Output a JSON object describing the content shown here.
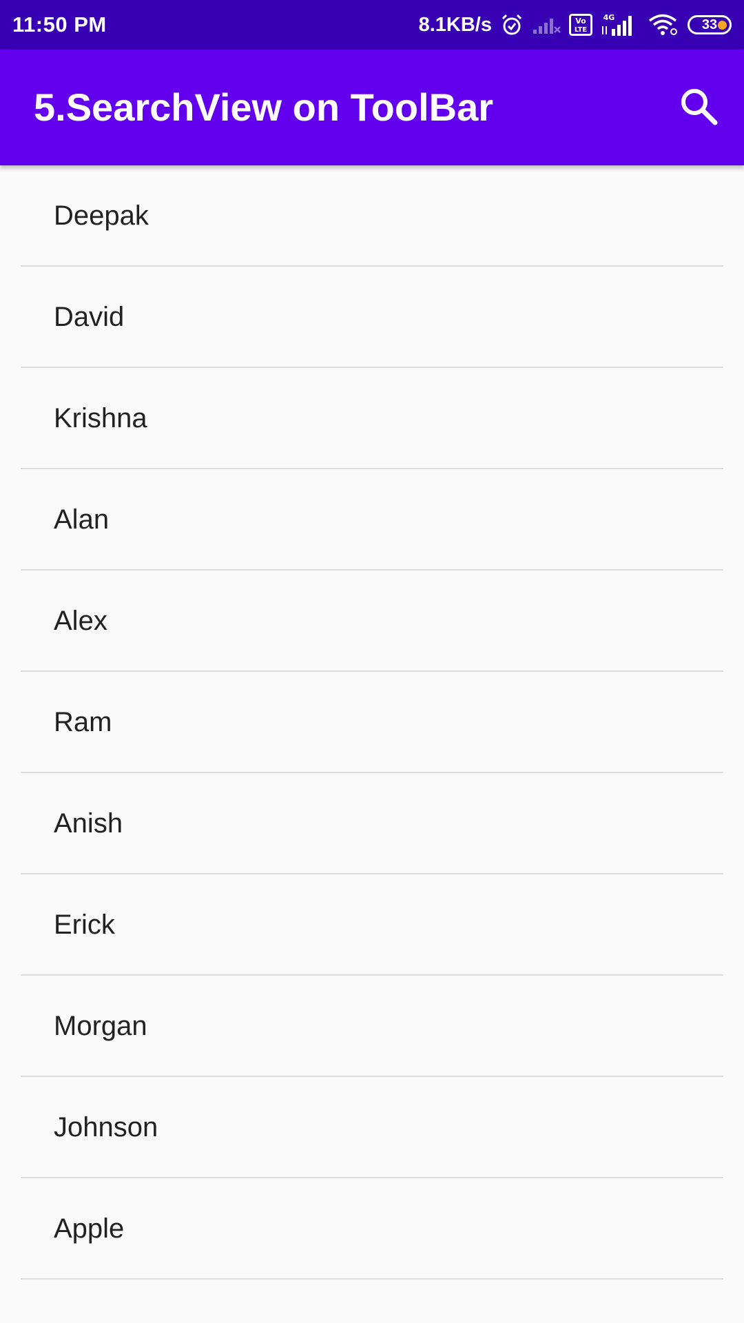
{
  "status_bar": {
    "time": "11:50 PM",
    "network_speed": "8.1KB/s",
    "volte_label": "Vo LTE",
    "network_type": "4G",
    "battery_level": "33",
    "background": "#3700b3",
    "battery_dot_color": "#f5a623",
    "icons": [
      "alarm-icon",
      "signal-weak-icon",
      "volte-icon",
      "signal-4g-icon",
      "wifi-icon",
      "battery-icon"
    ]
  },
  "toolbar": {
    "title": "5.SearchView on ToolBar",
    "background": "#6200ee",
    "action_icon": "search-icon"
  },
  "list": {
    "items": [
      {
        "label": "Deepak"
      },
      {
        "label": "David"
      },
      {
        "label": "Krishna"
      },
      {
        "label": "Alan"
      },
      {
        "label": "Alex"
      },
      {
        "label": "Ram"
      },
      {
        "label": "Anish"
      },
      {
        "label": "Erick"
      },
      {
        "label": "Morgan"
      },
      {
        "label": "Johnson"
      },
      {
        "label": "Apple"
      }
    ]
  }
}
